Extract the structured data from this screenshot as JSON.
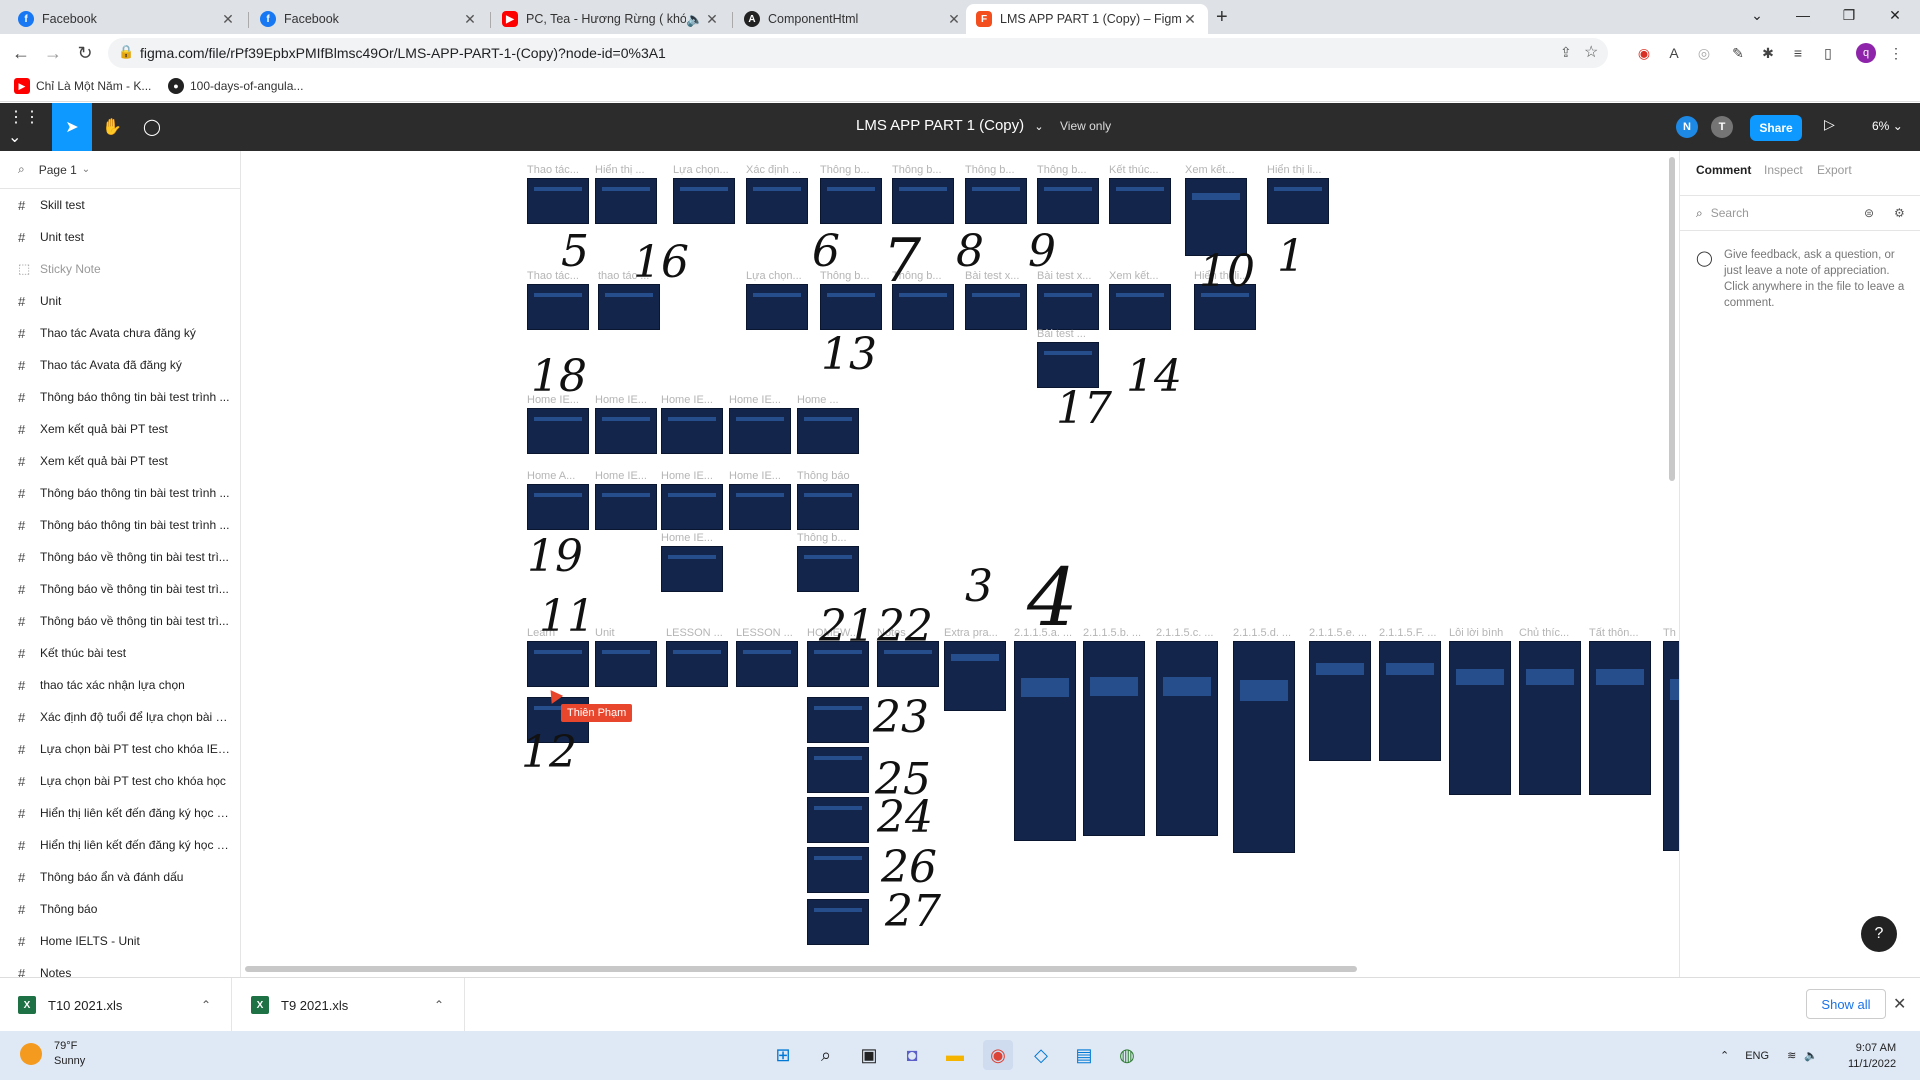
{
  "browser": {
    "tabs": [
      {
        "label": "Facebook",
        "icon": "facebook-icon",
        "color": "#1877f2"
      },
      {
        "label": "Facebook",
        "icon": "facebook-icon",
        "color": "#1877f2"
      },
      {
        "label": "PC, Tea - Hương Rừng ( khói",
        "icon": "youtube-icon",
        "color": "#ff0000"
      },
      {
        "label": "ComponentHtml",
        "icon": "angular-icon",
        "color": "#222222"
      },
      {
        "label": "LMS APP PART 1 (Copy) – Figma",
        "icon": "figma-icon",
        "color": "#f24e1e"
      }
    ],
    "new_tab": "+",
    "url": "figma.com/file/rPf39EpbxPMIfBlmsc49Or/LMS-APP-PART-1-(Copy)?node-id=0%3A1",
    "bookmarks": [
      {
        "label": "Chỉ Là Một Năm - K...",
        "icon": "youtube-icon"
      },
      {
        "label": "100-days-of-angula...",
        "icon": "github-icon"
      }
    ]
  },
  "figma": {
    "file_name": "LMS APP PART 1 (Copy)",
    "view_mode": "View only",
    "avatars": [
      "N",
      "T"
    ],
    "share_label": "Share",
    "zoom": "6%",
    "page_name": "Page 1",
    "layers": [
      {
        "label": "Skill test",
        "kind": "frame"
      },
      {
        "label": "Unit test",
        "kind": "frame"
      },
      {
        "label": "Sticky Note",
        "kind": "sticky"
      },
      {
        "label": "Unit",
        "kind": "frame"
      },
      {
        "label": "Thao tác Avata chưa đăng ký",
        "kind": "frame"
      },
      {
        "label": "Thao tác Avata đã đăng ký",
        "kind": "frame"
      },
      {
        "label": "Thông báo thông tin bài test trình ...",
        "kind": "frame"
      },
      {
        "label": "Xem kết quả bài PT test",
        "kind": "frame"
      },
      {
        "label": "Xem kết quả bài PT test",
        "kind": "frame"
      },
      {
        "label": "Thông báo thông tin bài test trình ...",
        "kind": "frame"
      },
      {
        "label": "Thông báo thông tin bài test trình ...",
        "kind": "frame"
      },
      {
        "label": "Thông báo về thông tin bài test trì...",
        "kind": "frame"
      },
      {
        "label": "Thông báo về thông tin bài test trì...",
        "kind": "frame"
      },
      {
        "label": "Thông báo về thông tin bài test trì...",
        "kind": "frame"
      },
      {
        "label": "Kết thúc bài test",
        "kind": "frame"
      },
      {
        "label": "thao tác xác nhận lựa chọn",
        "kind": "frame"
      },
      {
        "label": "Xác định độ tuổi để lựa chọn bài P...",
        "kind": "frame"
      },
      {
        "label": "Lựa chọn bài PT test cho khóa IEL...",
        "kind": "frame"
      },
      {
        "label": "Lựa chọn bài PT test cho khóa học",
        "kind": "frame"
      },
      {
        "label": "Hiển thị liên kết đến đăng ký học t...",
        "kind": "frame"
      },
      {
        "label": "Hiển thị liên kết đến đăng ký học t...",
        "kind": "frame"
      },
      {
        "label": "Thông báo ẩn và đánh dấu",
        "kind": "frame"
      },
      {
        "label": "Thông báo",
        "kind": "frame"
      },
      {
        "label": "Home IELTS - Unit",
        "kind": "frame"
      },
      {
        "label": "Notes",
        "kind": "frame"
      }
    ],
    "frame_titles": {
      "row1": [
        "Thao tác...",
        "Hiển thị ...",
        "Lựa chọn...",
        "Xác định ...",
        "Thông b...",
        "Thông b...",
        "Thông b...",
        "Thông b...",
        "Kết thúc...",
        "Xem kết...",
        "Hiển thị li..."
      ],
      "row2": [
        "Thao tác...",
        "thao tác ...",
        "Lựa chọn...",
        "Thông b...",
        "Thông b...",
        "Bài test x...",
        "Bài test x...",
        "Xem kết...",
        "Hiển thị li...",
        "Bài test ..."
      ],
      "row3": [
        "Home IE...",
        "Home IE...",
        "Home IE...",
        "Home IE...",
        "Home ..."
      ],
      "row4": [
        "Home A...",
        "Home IE...",
        "Home IE...",
        "Home IE...",
        "Thông báo",
        "Home IE...",
        "Thông b..."
      ],
      "row5": [
        "Learn",
        "Unit",
        "LESSON ...",
        "LESSON ...",
        "HOMEW...",
        "Notes",
        "Extra pra...",
        "2.1.1.5.a. ...",
        "2.1.1.5.b. ...",
        "2.1.1.5.c. ...",
        "2.1.1.5.d. ...",
        "2.1.1.5.e. ...",
        "2.1.1.5.F. ...",
        "Lỗi lời bình",
        "Chủ thíc...",
        "Tất thôn...",
        "Th"
      ]
    },
    "handwritten_numbers": [
      "5",
      "16",
      "6",
      "7",
      "8",
      "9",
      "10",
      "1",
      "13",
      "14",
      "18",
      "17",
      "19",
      "11",
      "21",
      "22",
      "3",
      "4",
      "12",
      "23",
      "25",
      "24",
      "26",
      "27"
    ],
    "cursor_user": "Thiên Phạm",
    "right_panel": {
      "tabs": [
        "Comment",
        "Inspect",
        "Export"
      ],
      "search_placeholder": "Search",
      "hint": "Give feedback, ask a question, or just leave a note of appreciation. Click anywhere in the file to leave a comment."
    },
    "help": "?"
  },
  "downloads": {
    "items": [
      {
        "label": "T10   2021.xls"
      },
      {
        "label": "T9 2021.xls"
      }
    ],
    "show_all": "Show all"
  },
  "taskbar": {
    "weather_temp": "79°F",
    "weather_desc": "Sunny",
    "lang": "ENG",
    "time": "9:07 AM",
    "date": "11/1/2022"
  },
  "colors": {
    "figma_toolbar": "#2c2c2c",
    "figma_accent": "#0d99ff",
    "frame_bg": "#13254a",
    "cursor": "#e8472e"
  }
}
